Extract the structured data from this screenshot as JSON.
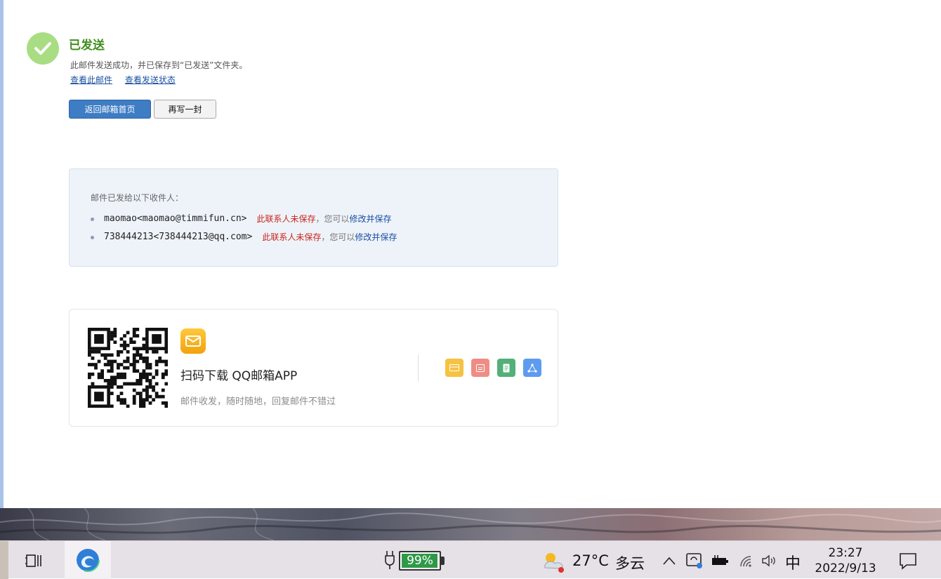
{
  "result": {
    "title": "已发送",
    "subtitle": "此邮件发送成功，并已保存到“已发送”文件夹。",
    "links": [
      "查看此邮件",
      "查看发送状态"
    ]
  },
  "buttons": {
    "back": "返回邮箱首页",
    "rewrite": "再写一封"
  },
  "recipients": {
    "heading": "邮件已发给以下收件人：",
    "items": [
      {
        "address": "maomao<maomao@timmifun.cn>",
        "status": "此联系人未保存",
        "separator": "，您可以",
        "action": "修改并保存"
      },
      {
        "address": "738444213<738444213@qq.com>",
        "status": "此联系人未保存",
        "separator": "，您可以",
        "action": "修改并保存"
      }
    ]
  },
  "app_promo": {
    "title": "扫码下载 QQ邮箱APP",
    "description": "邮件收发，随时随地，回复邮件不错过",
    "features": [
      {
        "icon": "mail-icon",
        "color": "#f5c242"
      },
      {
        "icon": "calendar-icon",
        "color": "#ee8d85"
      },
      {
        "icon": "note-icon",
        "color": "#52b078"
      },
      {
        "icon": "share-icon",
        "color": "#5d9bf0"
      }
    ]
  },
  "taskbar": {
    "battery_percent": 99,
    "battery_label": "99%",
    "weather_temp": "27°C",
    "weather_desc": "多云",
    "ime": "中",
    "time": "23:27",
    "date": "2022/9/13"
  },
  "colors": {
    "success_green": "#3f8f1f",
    "primary_blue": "#3e7cc4",
    "link_blue": "#1a4fa0",
    "warning_red": "#c8261e"
  }
}
